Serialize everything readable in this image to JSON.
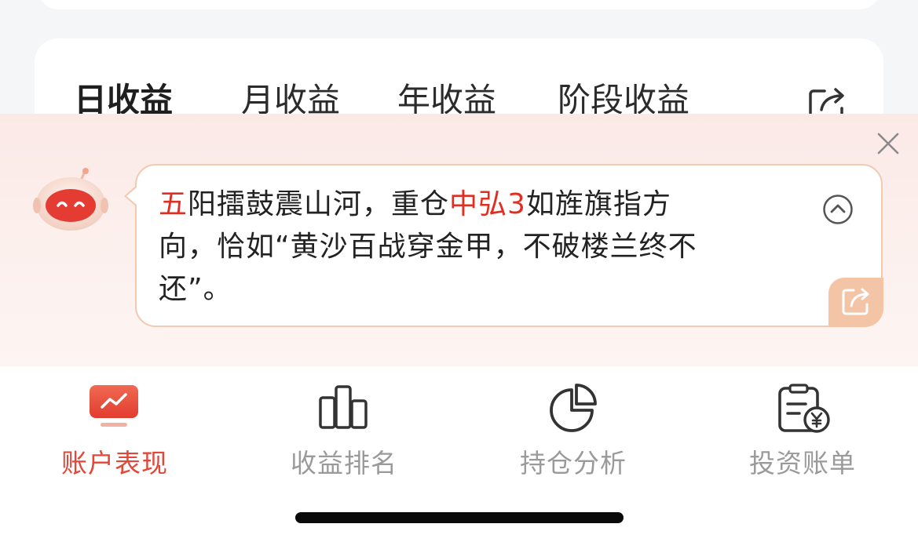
{
  "income_tabs": {
    "items": [
      {
        "label": "日收益",
        "active": true
      },
      {
        "label": "月收益",
        "active": false
      },
      {
        "label": "年收益",
        "active": false
      },
      {
        "label": "阶段收益",
        "active": false
      }
    ],
    "share_icon": "share-icon"
  },
  "ai_popup": {
    "avatar_icon": "robot-icon",
    "message": {
      "line1_hl1": "五",
      "line1_a": "阳擂鼓震山河，重仓",
      "line1_hl2": "中弘3",
      "line1_b": "如旌旗指方",
      "line2": "向，恰如“黄沙百战穿金甲，不破楼兰终不",
      "line3": "还”。"
    },
    "close_icon": "close-icon",
    "collapse_icon": "chevron-up-icon",
    "share_icon": "share-icon",
    "highlight_color": "#e02f22"
  },
  "bottom_nav": {
    "items": [
      {
        "label": "账户表现",
        "icon": "monitor-chart-icon",
        "active": true
      },
      {
        "label": "收益排名",
        "icon": "bar-chart-icon",
        "active": false
      },
      {
        "label": "持仓分析",
        "icon": "pie-chart-icon",
        "active": false
      },
      {
        "label": "投资账单",
        "icon": "bill-yen-icon",
        "active": false
      }
    ],
    "active_color": "#e2473a",
    "inactive_color": "#9a9a9a"
  }
}
